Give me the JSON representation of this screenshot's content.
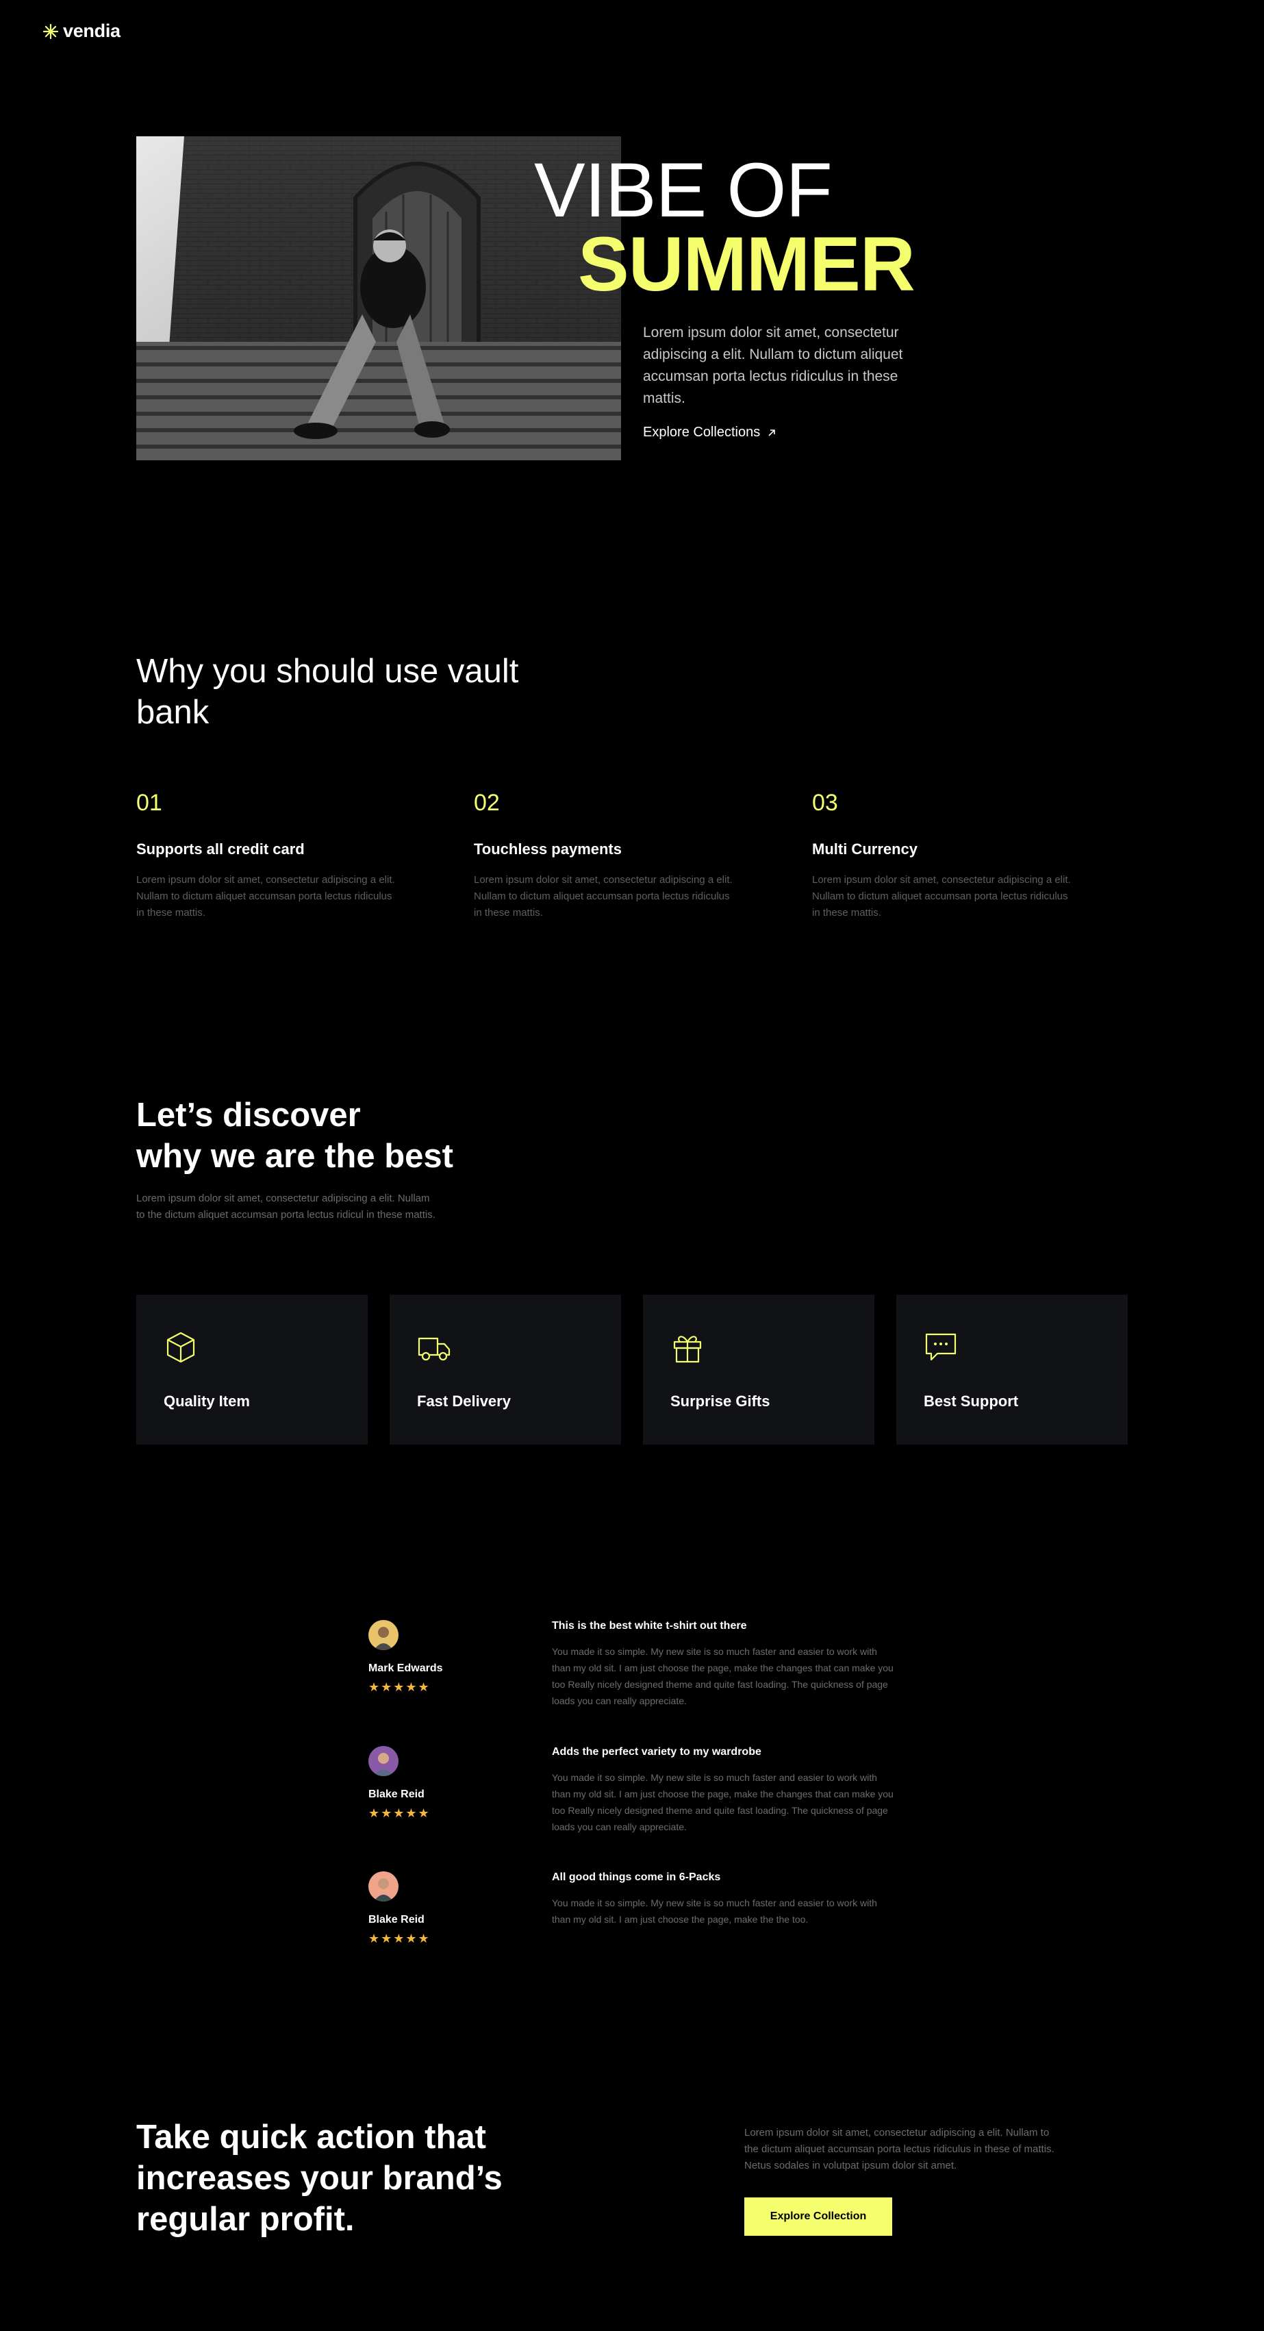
{
  "brand": {
    "name": "vendia",
    "logo_icon": "asterisk-logo-icon",
    "accent": "#f5ff6e"
  },
  "hero": {
    "title_line1": "VIBE OF",
    "title_line2": "SUMMER",
    "description": "Lorem ipsum dolor sit amet, consectetur adipiscing a elit. Nullam to dictum aliquet accumsan porta lectus ridiculus in these mattis.",
    "link_label": "Explore Collections",
    "link_icon": "arrow-up-right-icon",
    "image": "man-sitting-on-church-steps-photo"
  },
  "why": {
    "title": "Why you should use vault bank",
    "features": [
      {
        "num": "01",
        "title": "Supports all credit card",
        "desc": "Lorem ipsum dolor sit amet, consectetur adipiscing a elit. Nullam to dictum aliquet accumsan porta lectus ridiculus in these mattis."
      },
      {
        "num": "02",
        "title": "Touchless payments",
        "desc": "Lorem ipsum dolor sit amet, consectetur adipiscing a elit. Nullam to dictum aliquet accumsan porta lectus ridiculus in these mattis."
      },
      {
        "num": "03",
        "title": "Multi Currency",
        "desc": "Lorem ipsum dolor sit amet, consectetur adipiscing a elit. Nullam to dictum aliquet accumsan porta lectus ridiculus in these mattis."
      }
    ]
  },
  "discover": {
    "title_line1": "Let’s discover",
    "title_line2": "why we are the best",
    "description": "Lorem ipsum dolor sit amet, consectetur adipiscing a elit. Nullam to the dictum aliquet accumsan porta lectus ridicul in these mattis.",
    "cards": [
      {
        "label": "Quality Item",
        "icon": "box-icon"
      },
      {
        "label": "Fast Delivery",
        "icon": "truck-icon"
      },
      {
        "label": "Surprise Gifts",
        "icon": "gift-icon"
      },
      {
        "label": "Best Support",
        "icon": "chat-bubble-icon"
      }
    ]
  },
  "reviews": [
    {
      "name": "Mark Edwards",
      "stars": "★★★★★",
      "rating": 5,
      "title": "This is the best white t-shirt out there",
      "body": "You made it so simple. My new site is so much faster and easier to work with than my old sit. I am just choose the page, make the changes that can make you too Really nicely designed theme and quite fast loading. The quickness of page loads you can really appreciate.",
      "avatar_bg": "#e9c46a"
    },
    {
      "name": "Blake Reid",
      "stars": "★★★★★",
      "rating": 5,
      "title": "Adds the perfect variety to my wardrobe",
      "body": "You made it so simple. My new site is so much faster and easier to work with than my old sit. I am just choose the page, make the changes that can make you too Really nicely designed theme and quite fast loading. The quickness of page loads you can really appreciate.",
      "avatar_bg": "#8a5aa8"
    },
    {
      "name": "Blake Reid",
      "stars": "★★★★★",
      "rating": 5,
      "title": "All good things come in 6-Packs",
      "body": "You made it so simple. My new site is so much faster and easier to work with than my old sit. I am just choose the page, make the the too.",
      "avatar_bg": "#f0a58a"
    }
  ],
  "cta": {
    "title": "Take quick action that increases your brand’s regular profit.",
    "description": "Lorem ipsum dolor sit amet, consectetur adipiscing a elit. Nullam to the dictum aliquet accumsan porta lectus ridiculus in these of mattis. Netus sodales in volutpat ipsum dolor sit amet.",
    "button_label": "Explore Collection"
  }
}
